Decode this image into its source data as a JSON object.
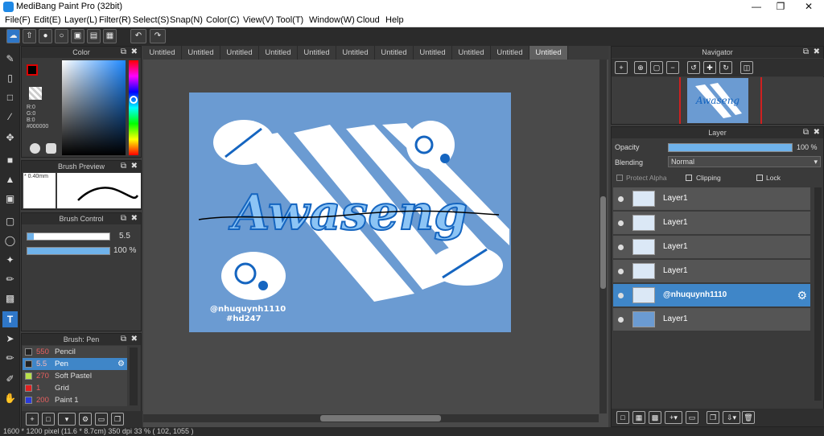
{
  "app": {
    "title": "MediBang Paint Pro (32bit)"
  },
  "menu": [
    "File(F)",
    "Edit(E)",
    "Layer(L)",
    "Filter(R)",
    "Select(S)",
    "Snap(N)",
    "Color(C)",
    "View(V)",
    "Tool(T)",
    "Window(W)",
    "Cloud",
    "Help"
  ],
  "panels": {
    "color": {
      "title": "Color",
      "r": "R:0",
      "g": "G:0",
      "b": "B:0",
      "hex": "#000000"
    },
    "brush_preview": {
      "title": "Brush Preview",
      "size": "* 0.40mm"
    },
    "brush_control": {
      "title": "Brush Control",
      "size_value": "5.5",
      "opacity_value": "100 %",
      "opacity_level": 1.0
    },
    "brush_list": {
      "title": "Brush: Pen",
      "items": [
        {
          "size": "550",
          "name": "Pencil",
          "swatch": "#222222"
        },
        {
          "size": "5.5",
          "name": "Pen",
          "swatch": "#222222"
        },
        {
          "size": "270",
          "name": "Soft Pastel",
          "swatch": "#b8e04a"
        },
        {
          "size": "1",
          "name": "Grid",
          "swatch": "#e02020"
        },
        {
          "size": "200",
          "name": "Paint 1",
          "swatch": "#2a3adb"
        }
      ]
    },
    "navigator": {
      "title": "Navigator"
    },
    "layer": {
      "title": "Layer",
      "opacity_label": "Opacity",
      "opacity_value": "100 %",
      "blending_label": "Blending",
      "blending_value": "Normal",
      "protect_alpha": "Protect Alpha",
      "clipping": "Clipping",
      "lock": "Lock",
      "layers": [
        {
          "name": "Layer1"
        },
        {
          "name": "Layer1"
        },
        {
          "name": "Layer1"
        },
        {
          "name": "Layer1"
        },
        {
          "name": "@nhuquynh1110"
        },
        {
          "name": "Layer1"
        }
      ]
    }
  },
  "tabs": [
    "Untitled",
    "Untitled",
    "Untitled",
    "Untitled",
    "Untitled",
    "Untitled",
    "Untitled",
    "Untitled",
    "Untitled",
    "Untitled",
    "Untitled"
  ],
  "artwork": {
    "title_text": "Awaseng",
    "watermark_line1": "@nhuquynh1110",
    "watermark_line2": "#hd247",
    "bg_color": "#6b9bd2"
  },
  "status": "1600 * 1200 pixel   (11.6 * 8.7cm)   350 dpi   33 %   ( 102, 1055 )"
}
